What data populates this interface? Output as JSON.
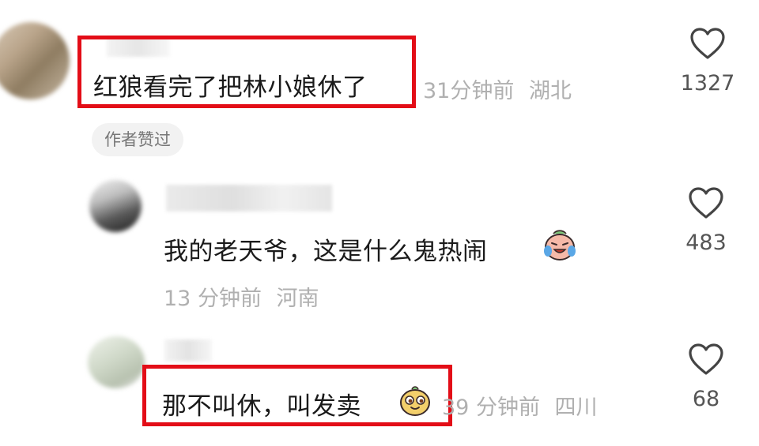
{
  "comments": [
    {
      "text": "红狼看完了把林小娘休了",
      "time": "31分钟前",
      "location": "湖北",
      "likes": "1327",
      "badge": "作者赞过",
      "highlighted": true
    },
    {
      "text": "我的老天爷，这是什么鬼热闹",
      "emoji": "crying-laughing-emoji",
      "time": "13 分钟前",
      "location": "河南",
      "likes": "483",
      "highlighted": false
    },
    {
      "text": "那不叫休，叫发卖",
      "emoji": "sly-face-emoji",
      "time": "39 分钟前",
      "location": "四川",
      "likes": "68",
      "highlighted": true
    }
  ],
  "icons": {
    "like": "heart-outline-icon"
  },
  "colors": {
    "highlight": "#e30d17",
    "meta": "#b0b0b0"
  }
}
